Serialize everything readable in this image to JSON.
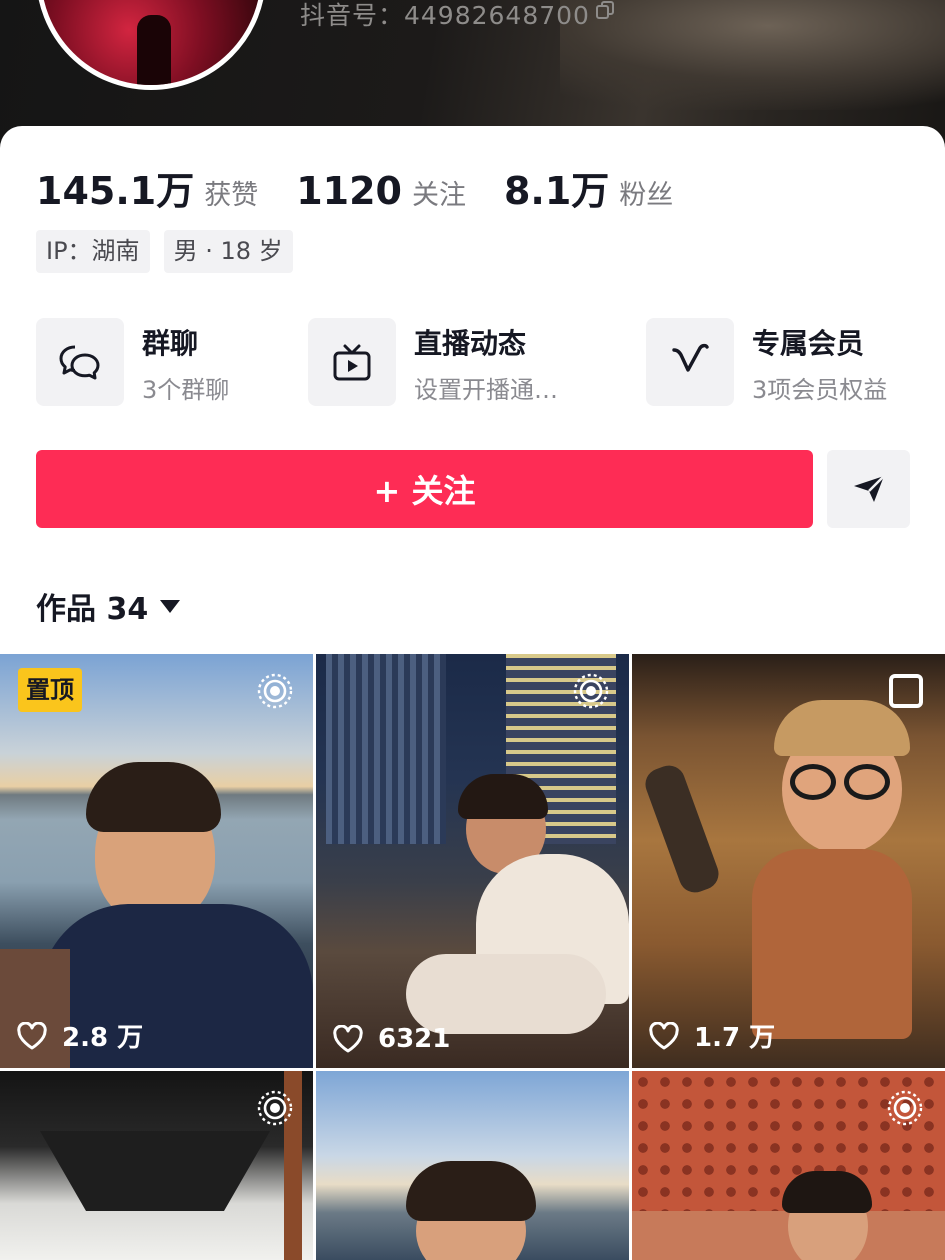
{
  "profile": {
    "douyin_id": "抖音号：44982648700"
  },
  "stats": [
    {
      "value": "145.1万",
      "label": "获赞"
    },
    {
      "value": "1120",
      "label": "关注"
    },
    {
      "value": "8.1万",
      "label": "粉丝"
    }
  ],
  "tags": [
    "IP：湖南",
    "男 · 18 岁"
  ],
  "features": [
    {
      "title": "群聊",
      "subtitle": "3个群聊",
      "icon": "chat-bubbles-icon"
    },
    {
      "title": "直播动态",
      "subtitle": "设置开播通…",
      "icon": "tv-play-icon"
    },
    {
      "title": "专属会员",
      "subtitle": "3项会员权益",
      "icon": "v-badge-icon"
    }
  ],
  "actions": {
    "follow_label": "+ 关注",
    "share_icon": "send-icon"
  },
  "works": {
    "label": "作品 34",
    "items": [
      {
        "likes": "2.8 万",
        "pinned": "置顶",
        "live": true
      },
      {
        "likes": "6321",
        "live": true
      },
      {
        "likes": "1.7 万",
        "live": false
      },
      {
        "likes": "",
        "live": true
      },
      {
        "likes": "",
        "live": false
      },
      {
        "likes": "",
        "live": true
      }
    ]
  },
  "colors": {
    "accent": "#fe2c55",
    "pin_badge": "#fac51c"
  }
}
